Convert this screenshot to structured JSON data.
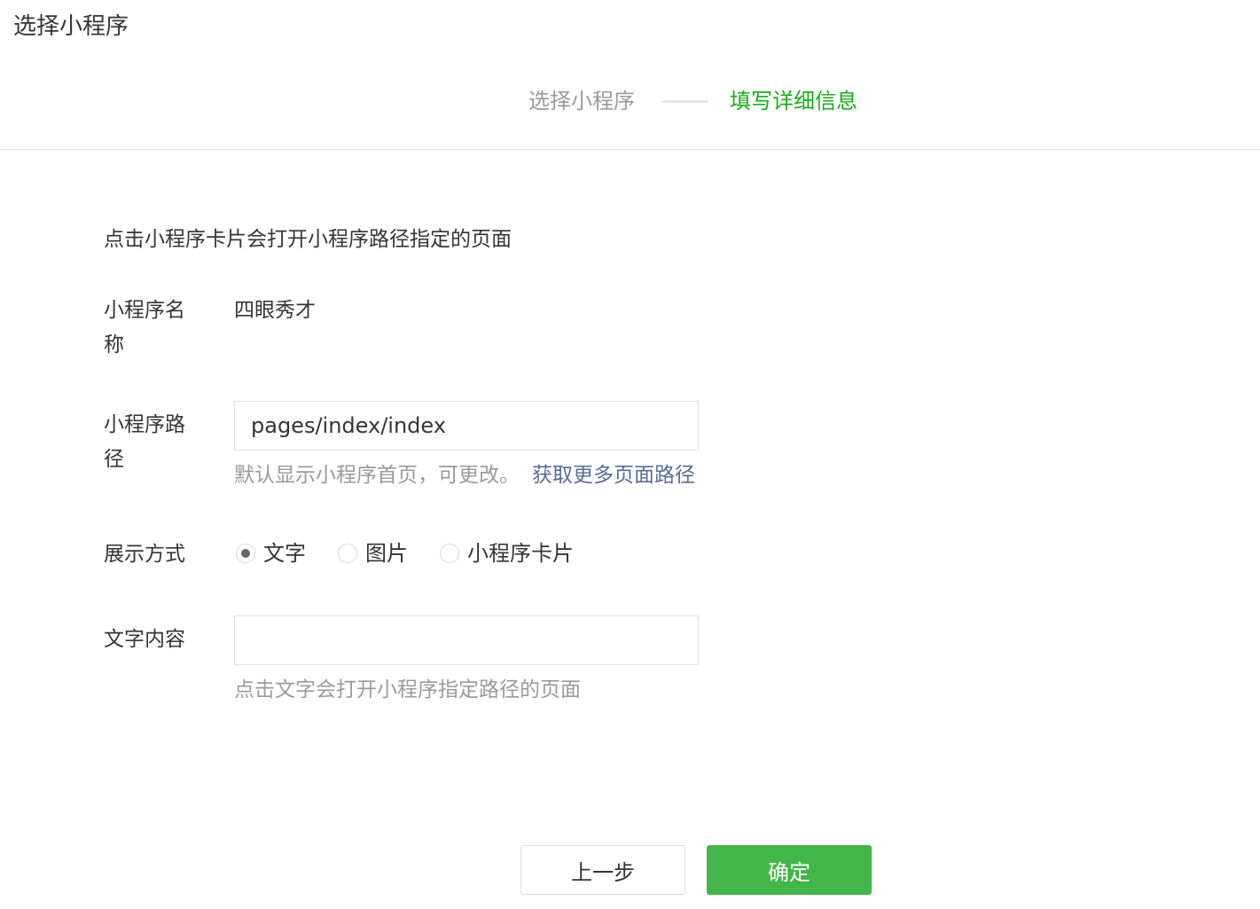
{
  "dialog": {
    "title": "选择小程序"
  },
  "steps": [
    {
      "label": "选择小程序",
      "state": "done"
    },
    {
      "label": "填写详细信息",
      "state": "active"
    }
  ],
  "form": {
    "description": "点击小程序卡片会打开小程序路径指定的页面",
    "name": {
      "label": "小程序名称",
      "value": "四眼秀才"
    },
    "path": {
      "label": "小程序路径",
      "value": "pages/index/index",
      "hint": "默认显示小程序首页，可更改。",
      "link": "获取更多页面路径"
    },
    "display": {
      "label": "展示方式",
      "options": [
        "文字",
        "图片",
        "小程序卡片"
      ],
      "selected": "文字"
    },
    "text_content": {
      "label": "文字内容",
      "value": "",
      "hint": "点击文字会打开小程序指定路径的页面"
    }
  },
  "buttons": {
    "prev": "上一步",
    "confirm": "确定"
  },
  "colors": {
    "accent_green": "#1aad19",
    "button_green": "#44b549",
    "link_blue": "#576b95",
    "muted_gray": "#9a9a9a"
  }
}
